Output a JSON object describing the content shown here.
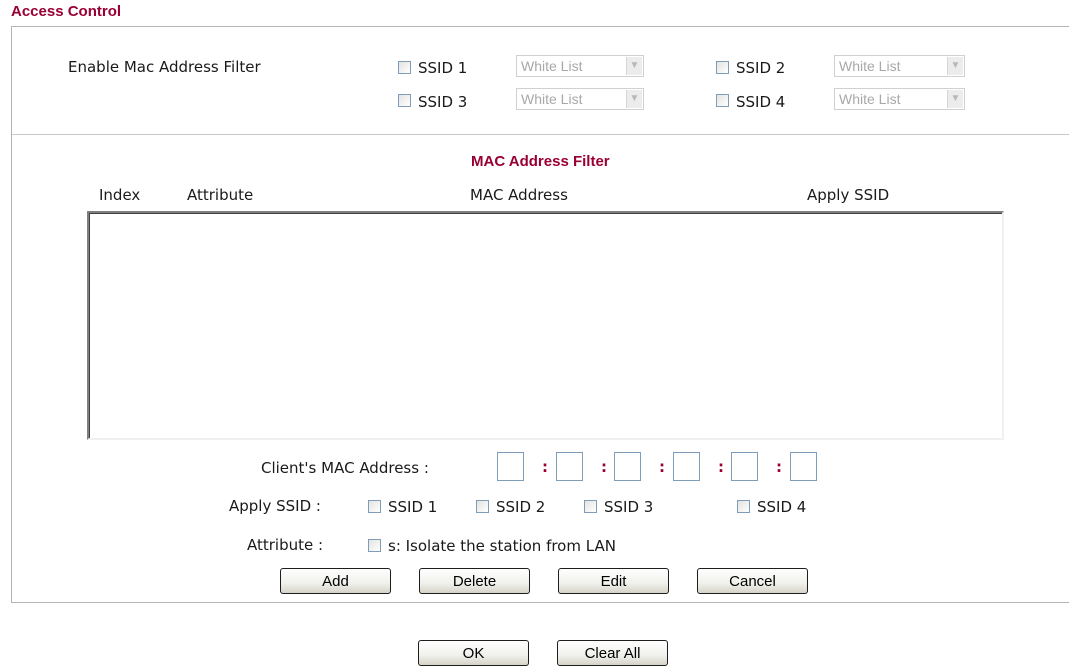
{
  "page_title": "Access Control",
  "enable_mac_filter": {
    "label": "Enable Mac Address Filter",
    "ssids": [
      {
        "label": "SSID 1",
        "mode": "White List",
        "checked": false
      },
      {
        "label": "SSID 2",
        "mode": "White List",
        "checked": false
      },
      {
        "label": "SSID 3",
        "mode": "White List",
        "checked": false
      },
      {
        "label": "SSID 4",
        "mode": "White List",
        "checked": false
      }
    ]
  },
  "mac_filter": {
    "title": "MAC Address Filter",
    "columns": [
      "Index",
      "Attribute",
      "MAC Address",
      "Apply SSID"
    ],
    "rows": []
  },
  "client_mac": {
    "label": "Client's MAC Address :",
    "octets": [
      "",
      "",
      "",
      "",
      "",
      ""
    ],
    "separator": ":"
  },
  "apply_ssid": {
    "label": "Apply SSID :",
    "options": [
      "SSID 1",
      "SSID 2",
      "SSID 3",
      "SSID 4"
    ]
  },
  "attribute": {
    "label": "Attribute :",
    "option": "s: Isolate the station from LAN"
  },
  "buttons": {
    "add": "Add",
    "delete": "Delete",
    "edit": "Edit",
    "cancel": "Cancel",
    "ok": "OK",
    "clear_all": "Clear All"
  },
  "colors": {
    "accent": "#990033",
    "border": "#b4b4b4"
  }
}
